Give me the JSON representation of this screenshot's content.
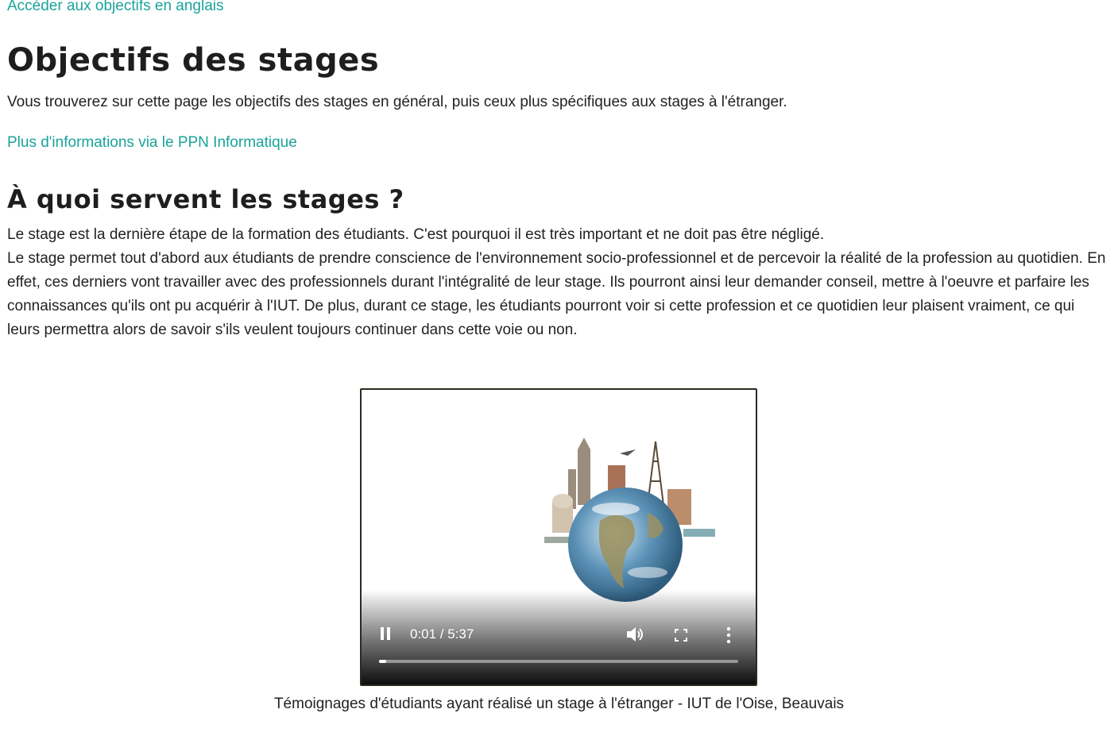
{
  "top_link": "Accéder aux objectifs en anglais",
  "title": "Objectifs des stages",
  "intro": "Vous trouverez sur cette page les objectifs des stages en général, puis ceux plus spécifiques aux stages à l'étranger.",
  "ppn_link": "Plus d'informations via le PPN Informatique",
  "section": {
    "heading": "À quoi servent les stages ?",
    "paragraph_1": "Le stage est la dernière étape de la formation des étudiants. C'est pourquoi il est très important et ne doit pas être négligé.",
    "paragraph_2": "Le stage permet tout d'abord aux étudiants de prendre conscience de l'environnement socio-professionnel et de percevoir la réalité de la profession au quotidien. En effet, ces derniers vont travailler avec des professionnels durant l'intégralité de leur stage. Ils pourront ainsi leur demander conseil, mettre à l'oeuvre et parfaire les connaissances qu'ils ont pu acquérir à l'IUT. De plus, durant ce stage, les étudiants pourront voir si cette profession et ce quotidien leur plaisent vraiment, ce qui leurs permettra alors de savoir s'ils veulent toujours continuer dans cette voie ou non."
  },
  "video": {
    "time": "0:01 / 5:37",
    "progress": 0.02,
    "caption": "Témoignages d'étudiants ayant réalisé un stage à l'étranger - IUT de l'Oise, Beauvais"
  },
  "colors": {
    "link": "#1aa39a",
    "text": "#222222"
  },
  "icons": [
    "pause-icon",
    "volume-icon",
    "fullscreen-icon",
    "more-options-icon"
  ]
}
